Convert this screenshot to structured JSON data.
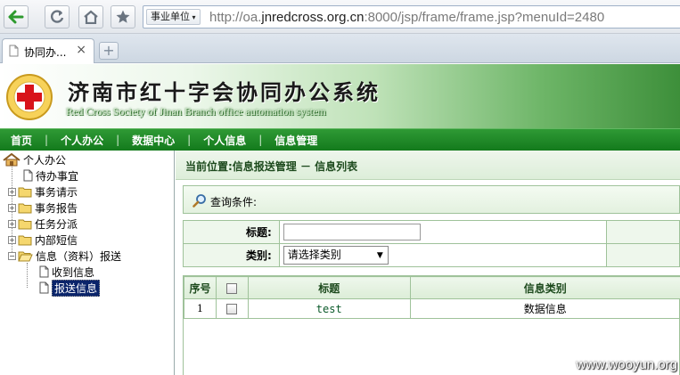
{
  "browser": {
    "zone_label": "事业单位",
    "url_prefix": "http://oa.",
    "url_host": "jnredcross.org.cn",
    "url_rest": ":8000/jsp/frame/frame.jsp?menuId=2480",
    "tab_title": "协同办...",
    "tab_close": "×",
    "new_tab": "+"
  },
  "banner": {
    "title": "济南市红十字会协同办公系统",
    "subtitle": "Red Cross Society of Jinan Branch office automation system"
  },
  "menu": [
    "首页",
    "个人办公",
    "数据中心",
    "个人信息",
    "信息管理"
  ],
  "menu_separator": "|",
  "tree": {
    "root": "个人办公",
    "items": [
      "待办事宜",
      "事务请示",
      "事务报告",
      "任务分派",
      "内部短信",
      "信息（资料）报送"
    ],
    "children": [
      "收到信息",
      "报送信息"
    ]
  },
  "content": {
    "breadcrumb": "当前位置:信息报送管理 － 信息列表",
    "query_label": "查询条件:",
    "form": {
      "title_label": "标题:",
      "title_value": "",
      "type_label": "类别:",
      "type_selected": "请选择类别"
    },
    "table": {
      "headers": [
        "序号",
        "",
        "标题",
        "信息类别"
      ],
      "rows": [
        {
          "index": "1",
          "title": "test",
          "category": "数据信息"
        }
      ]
    }
  },
  "watermark": "www.wooyun.org"
}
